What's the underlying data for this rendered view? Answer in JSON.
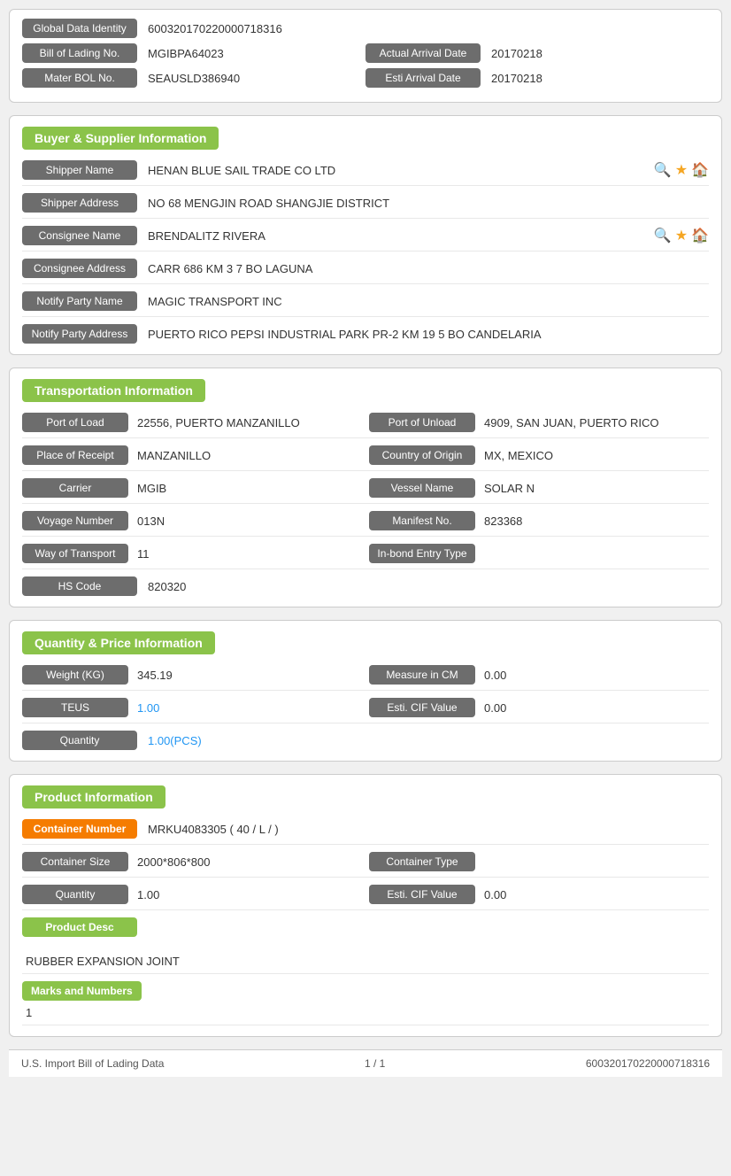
{
  "globalId": {
    "label": "Global Data Identity",
    "value": "600320170220000718316"
  },
  "billOfLading": {
    "label": "Bill of Lading No.",
    "value": "MGIBPA64023",
    "actualArrivalDateLabel": "Actual Arrival Date",
    "actualArrivalDateValue": "20170218"
  },
  "masterBOL": {
    "label": "Mater BOL No.",
    "value": "SEAUSLD386940",
    "estiArrivalDateLabel": "Esti Arrival Date",
    "estiArrivalDateValue": "20170218"
  },
  "buyerSupplierSection": {
    "header": "Buyer & Supplier Information",
    "shipperNameLabel": "Shipper Name",
    "shipperNameValue": "HENAN BLUE SAIL TRADE CO LTD",
    "shipperAddressLabel": "Shipper Address",
    "shipperAddressValue": "NO 68 MENGJIN ROAD SHANGJIE DISTRICT",
    "consigneeNameLabel": "Consignee Name",
    "consigneeNameValue": "BRENDALITZ RIVERA",
    "consigneeAddressLabel": "Consignee Address",
    "consigneeAddressValue": "CARR 686 KM 3 7 BO LAGUNA",
    "notifyPartyNameLabel": "Notify Party Name",
    "notifyPartyNameValue": "MAGIC TRANSPORT INC",
    "notifyPartyAddressLabel": "Notify Party Address",
    "notifyPartyAddressValue": "PUERTO RICO PEPSI INDUSTRIAL PARK PR-2 KM 19 5 BO CANDELARIA"
  },
  "transportSection": {
    "header": "Transportation Information",
    "portOfLoadLabel": "Port of Load",
    "portOfLoadValue": "22556, PUERTO MANZANILLO",
    "portOfUnloadLabel": "Port of Unload",
    "portOfUnloadValue": "4909, SAN JUAN, PUERTO RICO",
    "placeOfReceiptLabel": "Place of Receipt",
    "placeOfReceiptValue": "MANZANILLO",
    "countryOfOriginLabel": "Country of Origin",
    "countryOfOriginValue": "MX, MEXICO",
    "carrierLabel": "Carrier",
    "carrierValue": "MGIB",
    "vesselNameLabel": "Vessel Name",
    "vesselNameValue": "SOLAR N",
    "voyageNumberLabel": "Voyage Number",
    "voyageNumberValue": "013N",
    "manifestNoLabel": "Manifest No.",
    "manifestNoValue": "823368",
    "wayOfTransportLabel": "Way of Transport",
    "wayOfTransportValue": "11",
    "inBondEntryTypeLabel": "In-bond Entry Type",
    "inBondEntryTypeValue": "",
    "hsCodeLabel": "HS Code",
    "hsCodeValue": "820320"
  },
  "quantitySection": {
    "header": "Quantity & Price Information",
    "weightLabel": "Weight (KG)",
    "weightValue": "345.19",
    "measureInCMLabel": "Measure in CM",
    "measureInCMValue": "0.00",
    "teusLabel": "TEUS",
    "teusValue": "1.00",
    "estiCIFValueLabel": "Esti. CIF Value",
    "estiCIFValueValue": "0.00",
    "quantityLabel": "Quantity",
    "quantityValue": "1.00(PCS)"
  },
  "productSection": {
    "header": "Product Information",
    "containerNumberLabel": "Container Number",
    "containerNumberValue": "MRKU4083305 ( 40 / L / )",
    "containerSizeLabel": "Container Size",
    "containerSizeValue": "2000*806*800",
    "containerTypeLabel": "Container Type",
    "containerTypeValue": "",
    "quantityLabel": "Quantity",
    "quantityValue": "1.00",
    "estiCIFValueLabel": "Esti. CIF Value",
    "estiCIFValueValue": "0.00",
    "productDescLabel": "Product Desc",
    "productDescValue": "RUBBER EXPANSION JOINT",
    "marksAndNumbersLabel": "Marks and Numbers",
    "marksAndNumbersValue": "1"
  },
  "footer": {
    "leftText": "U.S. Import Bill of Lading Data",
    "centerText": "1 / 1",
    "rightText": "600320170220000718316"
  }
}
